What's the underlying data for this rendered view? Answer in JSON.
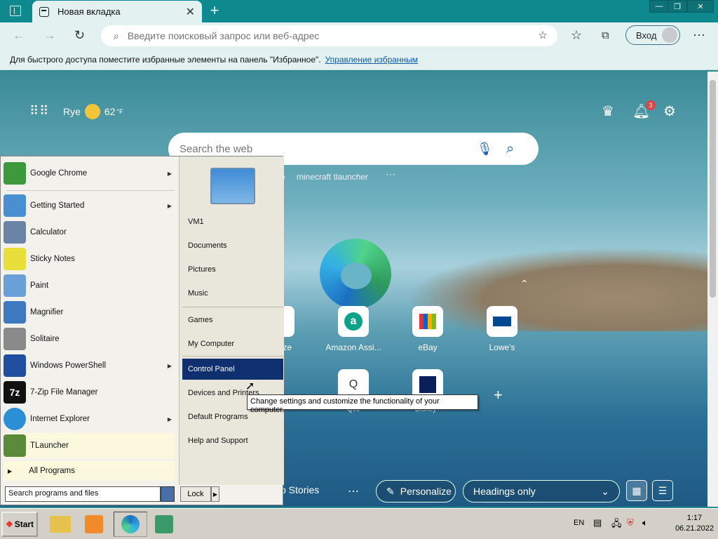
{
  "browser": {
    "tab_title": "Новая вкладка",
    "address_placeholder": "Введите поисковый запрос или веб-адрес",
    "profile_label": "Вход",
    "favbar_text": "Для быстрого доступа поместите избранные элементы на панель \"Избранное\".",
    "favbar_link": "Управление избранным"
  },
  "ntp": {
    "location": "Rye",
    "temperature": "62",
    "temp_unit": "°F",
    "notification_count": "3",
    "search_placeholder": "Search the web",
    "trending_1": "e",
    "trending_2": "minecraft tlauncher",
    "tiles": [
      {
        "label": "Amazon Assi..."
      },
      {
        "label": "eBay"
      },
      {
        "label": "Lowe's"
      },
      {
        "label": "Qvc"
      },
      {
        "label": "Disney+"
      }
    ],
    "tile_partial_label": "ze",
    "stories_label": "p Stories",
    "personalize_label": "Personalize",
    "headings_label": "Headings only"
  },
  "start_menu": {
    "pinned": [
      {
        "label": "Google Chrome",
        "icon": "chrome-icon",
        "color": "#3c9a3c"
      }
    ],
    "recent": [
      {
        "label": "Getting Started",
        "icon": "getting-started-icon",
        "color": "#4a8fd0",
        "arrow": true
      },
      {
        "label": "Calculator",
        "icon": "calculator-icon",
        "color": "#6a84a6",
        "arrow": false
      },
      {
        "label": "Sticky Notes",
        "icon": "sticky-notes-icon",
        "color": "#e8df3a",
        "arrow": false
      },
      {
        "label": "Paint",
        "icon": "paint-icon",
        "color": "#6aa0d8",
        "arrow": false
      },
      {
        "label": "Magnifier",
        "icon": "magnifier-icon",
        "color": "#3d78c0",
        "arrow": false
      },
      {
        "label": "Solitaire",
        "icon": "solitaire-icon",
        "color": "#8a8a8a",
        "arrow": false
      },
      {
        "label": "Windows PowerShell",
        "icon": "powershell-icon",
        "color": "#1f4f9e",
        "arrow": true
      },
      {
        "label": "7-Zip File Manager",
        "icon": "sevenzip-icon",
        "color": "#111111",
        "arrow": false
      },
      {
        "label": "Internet Explorer",
        "icon": "internet-explorer-icon",
        "color": "#2b8fd6",
        "arrow": true
      },
      {
        "label": "TLauncher",
        "icon": "tlauncher-icon",
        "color": "#5a8a3a",
        "arrow": false
      }
    ],
    "all_programs": "All Programs",
    "right_items": [
      {
        "label": "VM1"
      },
      {
        "label": "Documents"
      },
      {
        "label": "Pictures"
      },
      {
        "label": "Music"
      },
      {
        "label": "Games"
      },
      {
        "label": "My Computer"
      },
      {
        "label": "Control Panel"
      },
      {
        "label": "Devices and Printers"
      },
      {
        "label": "Default Programs"
      },
      {
        "label": "Help and Support"
      }
    ],
    "search_value": "Search programs and files",
    "lock_label": "Lock",
    "tooltip": "Change settings and customize the functionality of your computer."
  },
  "taskbar": {
    "start_label": "Start",
    "language": "EN",
    "time": "1:17",
    "date": "06.21.2022"
  }
}
